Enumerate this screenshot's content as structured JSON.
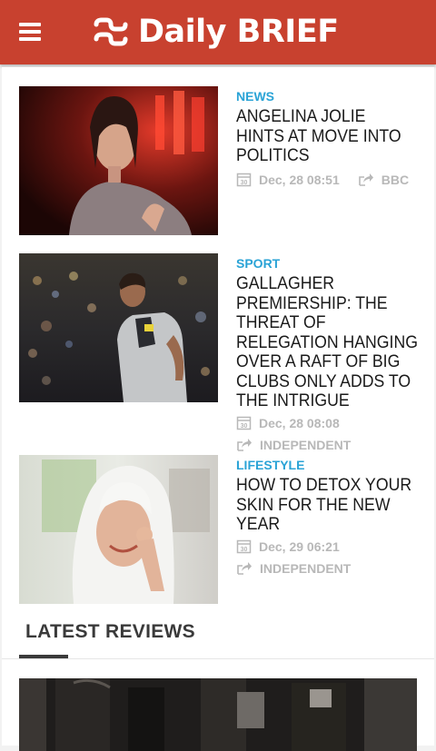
{
  "header": {
    "logo_text": "Daily BRIEF",
    "logo_mark": "logo-icon",
    "menu_icon": "hamburger-menu-icon",
    "color": "#c8412f"
  },
  "articles": [
    {
      "category": "NEWS",
      "headline": "ANGELINA JOLIE HINTS AT MOVE INTO POLITICS",
      "date": "Dec, 28 08:51",
      "source": "BBC",
      "image": "portrait photo of woman speaking at microphone"
    },
    {
      "category": "SPORT",
      "headline": "GALLAGHER PREMIERSHIP: THE THREAT OF RELEGATION HANGING OVER A RAFT OF BIG CLUBS ONLY ADDS TO THE INTRIGUE",
      "date": "Dec, 28 08:08",
      "source": "INDEPENDENT",
      "image": "rugby player in stadium"
    },
    {
      "category": "LIFESTYLE",
      "headline": "HOW TO DETOX YOUR SKIN FOR THE NEW YEAR",
      "date": "Dec, 29 06:21",
      "source": "INDEPENDENT",
      "image": "smiling woman with towel applying cream"
    }
  ],
  "section": {
    "title": "LATEST REVIEWS"
  },
  "colors": {
    "category": "#2aa3d6",
    "meta": "#b8b8b8",
    "headline": "#1a1a1a"
  }
}
